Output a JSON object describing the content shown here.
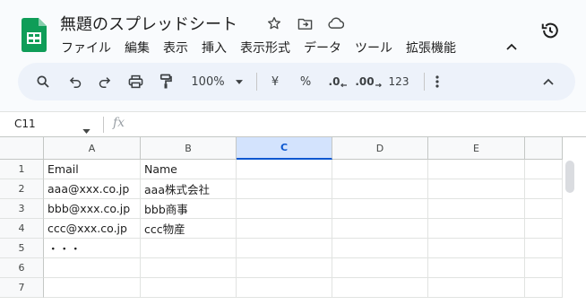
{
  "header": {
    "title": "無題のスプレッドシート",
    "menus": [
      "ファイル",
      "編集",
      "表示",
      "挿入",
      "表示形式",
      "データ",
      "ツール",
      "拡張機能"
    ]
  },
  "toolbar": {
    "zoom": "100%",
    "currency": "¥",
    "percent": "%",
    "decrease_decimal": ".0",
    "increase_decimal": ".00",
    "number_format": "123"
  },
  "formula_bar": {
    "cell_ref": "C11",
    "fx": "fx",
    "value": ""
  },
  "grid": {
    "columns": [
      "A",
      "B",
      "C",
      "D",
      "E"
    ],
    "selected_column": "C",
    "rows": [
      {
        "num": "1",
        "a": "Email",
        "b": "Name"
      },
      {
        "num": "2",
        "a": "aaa@xxx.co.jp",
        "b": "aaa株式会社"
      },
      {
        "num": "3",
        "a": "bbb@xxx.co.jp",
        "b": "bbb商事"
      },
      {
        "num": "4",
        "a": "ccc@xxx.co.jp",
        "b": "ccc物産"
      },
      {
        "num": "5",
        "a": "・・・",
        "b": ""
      },
      {
        "num": "6",
        "a": "",
        "b": ""
      },
      {
        "num": "7",
        "a": "",
        "b": ""
      }
    ]
  },
  "colors": {
    "accent": "#0b57d0",
    "logo": "#0f9d58",
    "toolbar_bg": "#edf2fa",
    "selected_header": "#d3e3fd"
  }
}
